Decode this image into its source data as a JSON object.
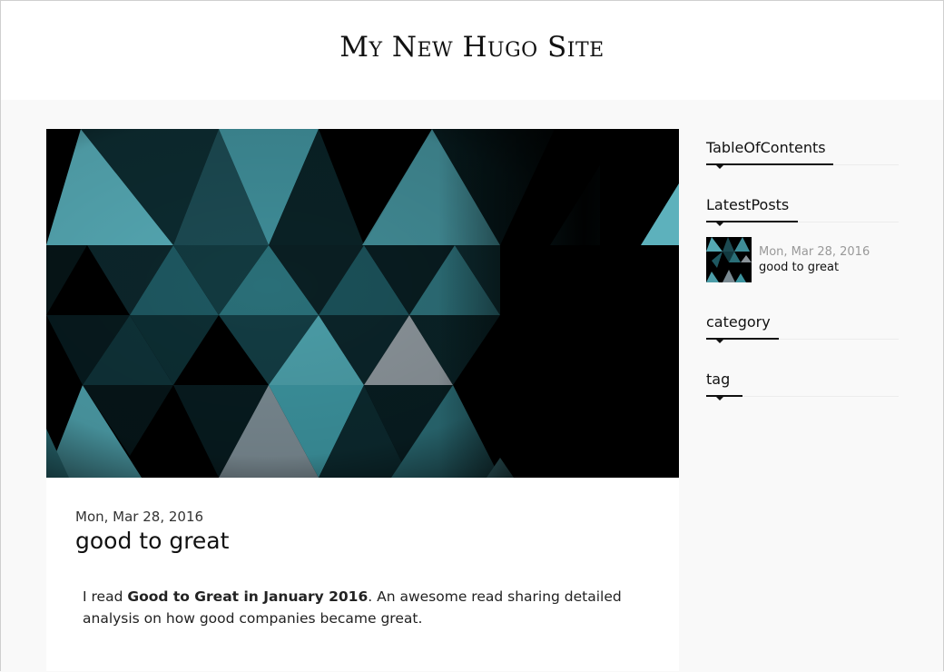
{
  "site": {
    "title": "My New Hugo Site"
  },
  "post": {
    "date": "Mon, Mar 28, 2016",
    "title": "good to great",
    "body_prefix": "I read ",
    "body_bold": "Good to Great in January 2016",
    "body_suffix": ". An awesome read sharing detailed analysis on how good companies became great."
  },
  "sidebar": {
    "toc_title": "TableOfContents",
    "latest_title": "LatestPosts",
    "latest_posts": [
      {
        "date": "Mon, Mar 28, 2016",
        "title": "good to great"
      }
    ],
    "category_title": "category",
    "tag_title": "tag"
  },
  "colors": {
    "teal": "#4fa3ae",
    "dark_teal": "#1d4c54",
    "deep_teal": "#0f2e33",
    "grey": "#7b8a92"
  }
}
